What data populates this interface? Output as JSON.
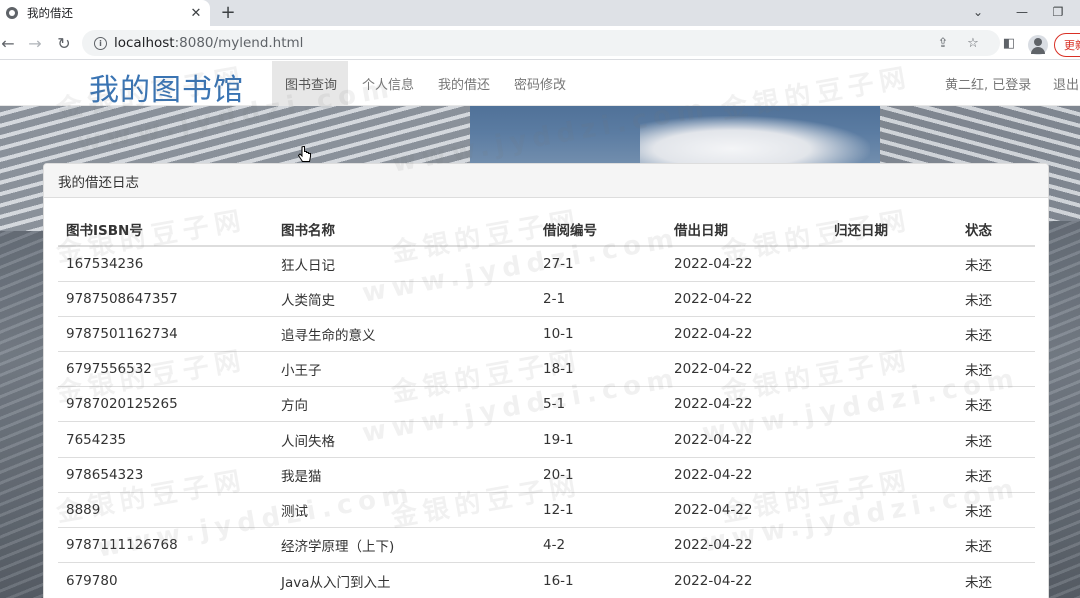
{
  "browser": {
    "tab_title": "我的借还",
    "url_host": "localhost",
    "url_rest": ":8080/mylend.html",
    "update_label": "更新"
  },
  "site": {
    "brand": "我的图书馆",
    "nav": [
      {
        "label": "图书查询",
        "active": true
      },
      {
        "label": "个人信息",
        "active": false
      },
      {
        "label": "我的借还",
        "active": false
      },
      {
        "label": "密码修改",
        "active": false
      }
    ],
    "user_status": "黄二红, 已登录",
    "logout": "退出"
  },
  "panel": {
    "title": "我的借还日志",
    "columns": [
      "图书ISBN号",
      "图书名称",
      "借阅编号",
      "借出日期",
      "归还日期",
      "状态"
    ],
    "rows": [
      [
        "167534236",
        "狂人日记",
        "27-1",
        "2022-04-22",
        "",
        "未还"
      ],
      [
        "9787508647357",
        "人类简史",
        "2-1",
        "2022-04-22",
        "",
        "未还"
      ],
      [
        "9787501162734",
        "追寻生命的意义",
        "10-1",
        "2022-04-22",
        "",
        "未还"
      ],
      [
        "6797556532",
        "小王子",
        "18-1",
        "2022-04-22",
        "",
        "未还"
      ],
      [
        "9787020125265",
        "方向",
        "5-1",
        "2022-04-22",
        "",
        "未还"
      ],
      [
        "7654235",
        "人间失格",
        "19-1",
        "2022-04-22",
        "",
        "未还"
      ],
      [
        "978654323",
        "我是猫",
        "20-1",
        "2022-04-22",
        "",
        "未还"
      ],
      [
        "8889",
        "测试",
        "12-1",
        "2022-04-22",
        "",
        "未还"
      ],
      [
        "9787111126768",
        "经济学原理（上下)",
        "4-2",
        "2022-04-22",
        "",
        "未还"
      ],
      [
        "679780",
        "Java从入门到入土",
        "16-1",
        "2022-04-22",
        "",
        "未还"
      ]
    ]
  },
  "watermarks": {
    "cn": "金银的豆子网",
    "en": "www.jyddzi.com"
  }
}
